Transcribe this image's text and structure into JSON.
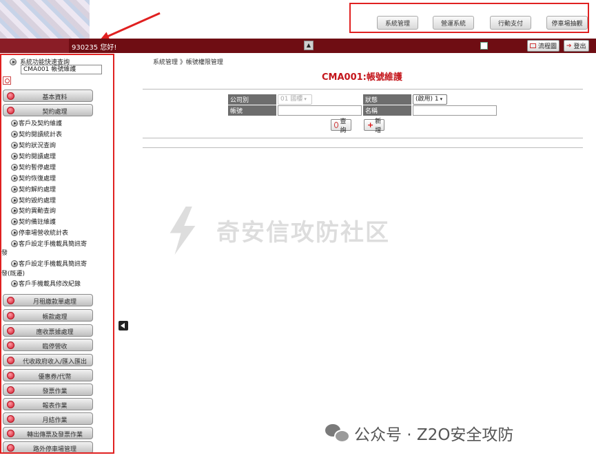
{
  "header": {
    "top_nav": [
      "系統管理",
      "營運系統",
      "行動支付",
      "停車場抽觀"
    ],
    "user_greeting": "930235 您好!",
    "flow_button": "流程圖",
    "logout_button": "登出"
  },
  "sidebar": {
    "quick_label": "系統功能快速查詢",
    "quick_value": "CMA001 帳號維護",
    "groups": [
      "基本資料",
      "契約處理",
      "月租繳款單處理",
      "帳款處理",
      "應收票據處理",
      "臨停營收",
      "代收政府收入/匯入匯出",
      "優惠券/代幣",
      "發票作業",
      "報表作業",
      "月結作業",
      "轉出傳票及發票作業",
      "路外停車場管理"
    ],
    "contract_items": [
      "客戶及契約維護",
      "契約閱讀統計表",
      "契約狀況查詢",
      "契約閱讀處理",
      "契約暫停處理",
      "契約恢復處理",
      "契約解約處理",
      "契約毀約處理",
      "契約異動查詢",
      "契約備註維護",
      "停車場營收統計表",
      "客戶設定手機載具簡訊寄",
      "客戶設定手機載具簡訊寄",
      "客戶手機載具修改紀錄"
    ],
    "wrap_tails": [
      "發",
      "發(既遷)"
    ]
  },
  "main": {
    "breadcrumb": "系統管理 》帳號權限管理",
    "title": "CMA001:帳號維護",
    "form": {
      "company_label": "公司別",
      "company_value": "01 國樓",
      "status_label": "狀態",
      "status_value": "(啟用) 1",
      "account_label": "帳號",
      "account_value": "",
      "name_label": "名稱",
      "name_value": ""
    },
    "query_button": "查詢",
    "add_button": "新增"
  },
  "watermarks": {
    "center": "奇安信攻防社区",
    "bottom": "公众号 · Z2O安全攻防"
  },
  "colors": {
    "header_bar": "#6f0d13",
    "highlight_border": "#e02020",
    "title_red": "#c4161c"
  }
}
